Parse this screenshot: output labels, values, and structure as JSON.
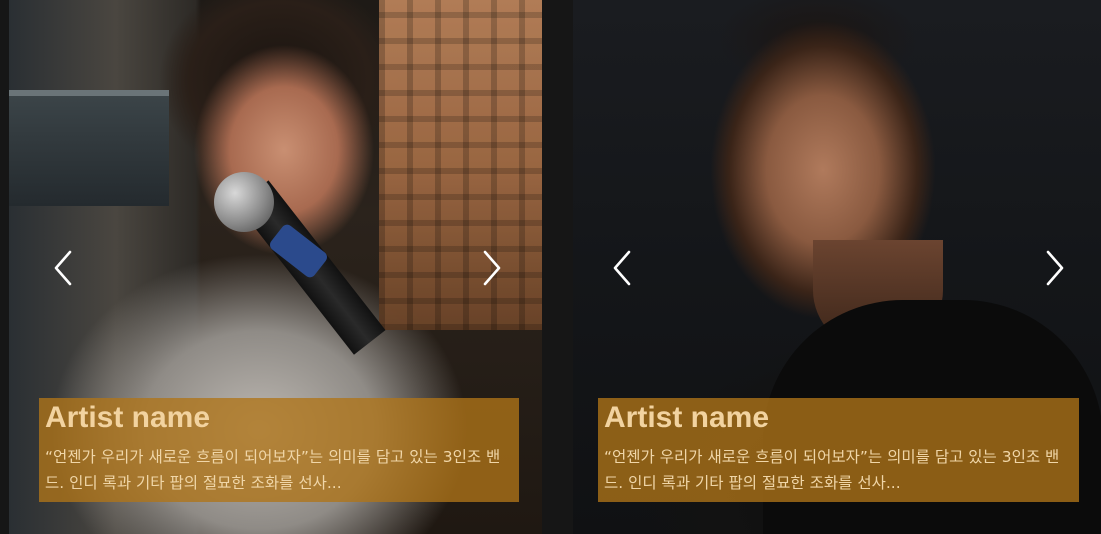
{
  "carousel": {
    "cards": [
      {
        "artist_name": "Artist name",
        "description": "“언젠가 우리가 새로운 흐름이 되어보자”는 의미를 담고 있는 3인조 밴드. 인디 록과 기타 팝의 절묘한 조화를 선사...",
        "prev_icon": "chevron-left-icon",
        "next_icon": "chevron-right-icon"
      },
      {
        "artist_name": "Artist name",
        "description": "“언젠가 우리가 새로운 흐름이 되어보자”는 의미를 담고 있는 3인조 밴드. 인디 록과 기타 팝의 절묘한 조화를 선사...",
        "prev_icon": "chevron-left-icon",
        "next_icon": "chevron-right-icon"
      }
    ]
  },
  "colors": {
    "background": "#161616",
    "caption_overlay": "#b07418",
    "caption_text": "#f2d3a0",
    "arrow": "#ffffff"
  }
}
